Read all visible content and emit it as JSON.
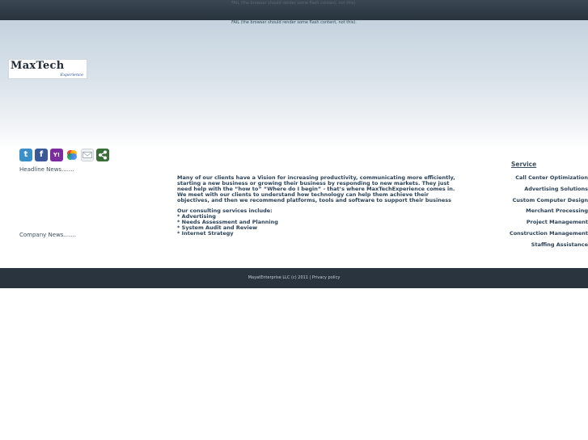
{
  "flash": {
    "top_message": "FAIL (the browser should render some flash content, not this).",
    "second_message": "FAIL (the browser should render some flash content, not this)."
  },
  "logo": {
    "text": "MaxTech",
    "subtext": "Experience"
  },
  "social": [
    {
      "name": "twitter",
      "glyph": "t",
      "color": "#3a8fc9"
    },
    {
      "name": "facebook",
      "glyph": "f",
      "color": "#3b5998"
    },
    {
      "name": "yahoo",
      "glyph": "Y!",
      "color": "#7b2c9e"
    },
    {
      "name": "google",
      "glyph": "",
      "color": "#ffffff"
    },
    {
      "name": "email",
      "glyph": "",
      "color": "#eef0f2"
    },
    {
      "name": "share",
      "glyph": "",
      "color": "#3a6e3a"
    }
  ],
  "sidebar": {
    "headline_news": "Headline News.......",
    "company_news": "Company News......."
  },
  "main": {
    "intro": "Many of our clients have a Vision for increasing productivity, communicating more efficiently, starting a new business or growing their business by responding to new markets. They just need help with the “how to” “Where do I begin” - that’s where MaxTechExperience comes in. We meet with our clients to understand how technology can help them achieve their objectives, and then we recommend platforms, tools and software to support their business",
    "consult_heading": "Our consulting services include:",
    "consult_items": [
      "* Advertising",
      "* Needs Assessment and Planning",
      "* System Audit and Review",
      "* Internet Strategy"
    ]
  },
  "service": {
    "title": "Service",
    "items": [
      "Call Center Optimization",
      "Advertising Solutions",
      "Custom Computer Design",
      "Merchant Processing",
      "Project Management",
      "Construction Management",
      "Staffing Assistance"
    ]
  },
  "footer": {
    "text": "MayatEnterprise LLC (c) 2011 | Privacy policy"
  },
  "colors": {
    "topbar": "#27323c",
    "footer": "#2a343e",
    "text": "#2b4257"
  }
}
